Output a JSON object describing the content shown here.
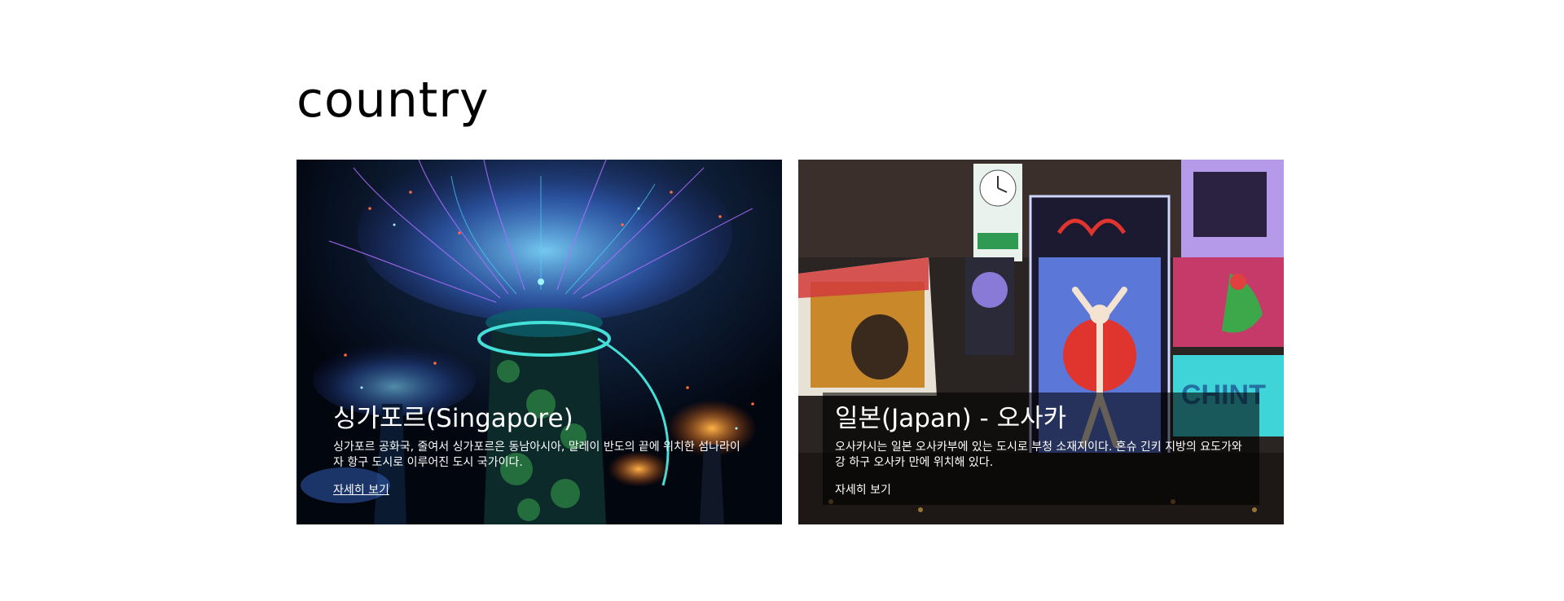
{
  "section": {
    "title": "country"
  },
  "cards": [
    {
      "title": "싱가포르(Singapore)",
      "description": "싱가포르 공화국, 줄여서 싱가포르은 동남아시아, 말레이 반도의 끝에 위치한 섬나라이자 항구 도시로 이루어진 도시 국가이다.",
      "link_label": "자세히 보기",
      "image": "Gardens by the Bay supertree grove at night"
    },
    {
      "title": "일본(Japan) - 오사카",
      "description": "오사카시는 일본 오사카부에 있는 도시로 부청 소재지이다. 혼슈 긴키 지방의 요도가와 강 하구 오사카 만에 위치해 있다.",
      "link_label": "자세히 보기",
      "image": "Dotonbori neon signs with Glico running man"
    }
  ],
  "colors": {
    "background": "#ffffff",
    "title": "#000000",
    "caption_text": "#ffffff",
    "caption_overlay": "rgba(0,0,0,0.58)"
  }
}
